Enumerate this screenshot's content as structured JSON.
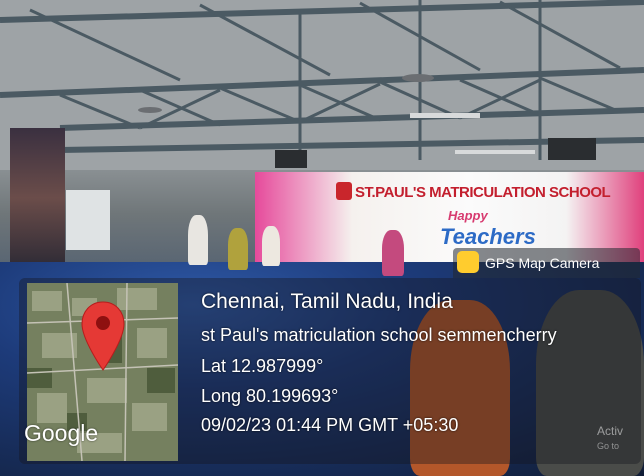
{
  "banner": {
    "school_name": "ST.PAUL'S MATRICULATION SCHOOL",
    "happy_text": "Happy",
    "teachers_text": "Teachers"
  },
  "gps": {
    "app_label": "GPS Map Camera",
    "city": "Chennai, Tamil Nadu, India",
    "address": "st Paul's matriculation school semmencherry",
    "latitude": "Lat 12.987999°",
    "longitude": "Long 80.199693°",
    "datetime": "09/02/23 01:44 PM GMT +05:30",
    "map_logo": "Google"
  },
  "watermark": {
    "line1": "Activ",
    "line2": "Go to"
  },
  "colors": {
    "pin": "#e53935",
    "banner_title": "#c31f2e",
    "app_icon": "#ffcc2e"
  }
}
